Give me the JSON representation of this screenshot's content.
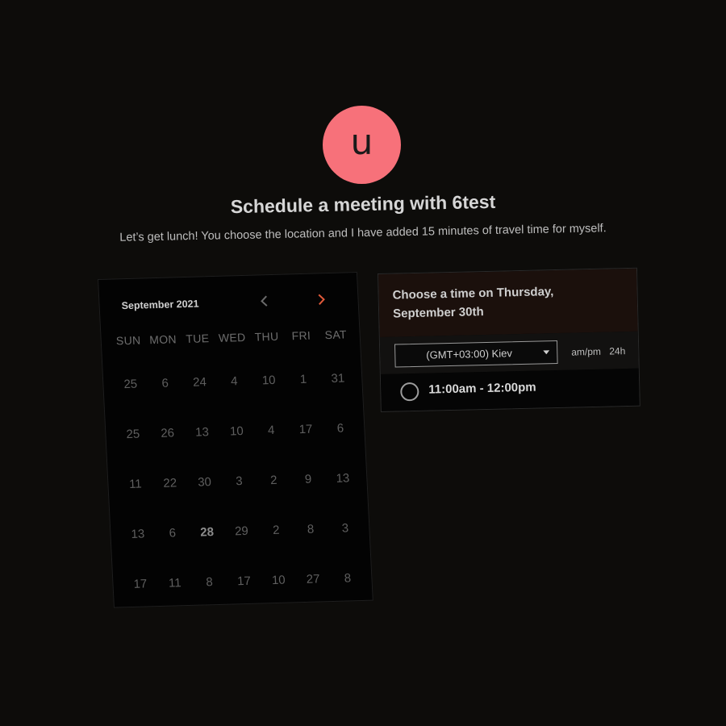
{
  "avatar": {
    "letter": "u",
    "color": "#f7717a"
  },
  "header": {
    "title": "Schedule a meeting with 6test",
    "subtitle": "Let’s get lunch! You choose the location and I have added 15 minutes of travel time for myself."
  },
  "calendar": {
    "month_label": "September 2021",
    "prev_icon": "chevron-left-icon",
    "next_icon": "chevron-right-icon",
    "accent": "#e25a3a",
    "weekdays": [
      "SUN",
      "MON",
      "TUE",
      "WED",
      "THU",
      "FRI",
      "SAT"
    ],
    "weeks": [
      [
        "25",
        "6",
        "24",
        "4",
        "10",
        "1",
        "31"
      ],
      [
        "25",
        "26",
        "13",
        "10",
        "4",
        "17",
        "6"
      ],
      [
        "11",
        "22",
        "30",
        "3",
        "2",
        "9",
        "13"
      ],
      [
        "13",
        "6",
        "28",
        "29",
        "2",
        "8",
        "3"
      ],
      [
        "17",
        "11",
        "8",
        "17",
        "10",
        "27",
        "8"
      ]
    ],
    "highlighted_day": "28"
  },
  "time_panel": {
    "title": "Choose a time on Thursday, September 30th",
    "timezone": "(GMT+03:00) Kiev",
    "format_12": "am/pm",
    "format_24": "24h",
    "slots": [
      {
        "label": "11:00am - 12:00pm"
      }
    ]
  }
}
